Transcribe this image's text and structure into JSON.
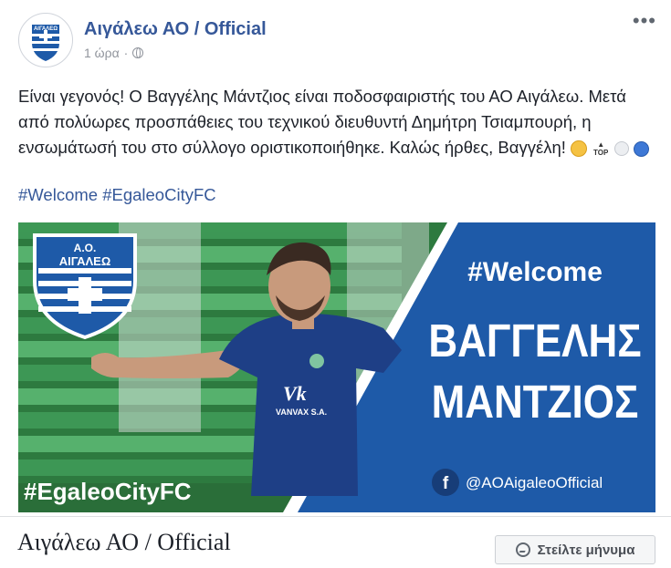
{
  "header": {
    "page_name": "Αιγάλεω ΑΟ / Official",
    "time": "1 ώρα",
    "separator": "·",
    "more_icon": "more-dots-icon",
    "privacy_icon": "globe-icon"
  },
  "post": {
    "text": "Είναι γεγονός! Ο Βαγγέλης Μάντζιος είναι ποδοσφαιριστής του ΑΟ Αιγάλεω. Μετά από πολύωρες προσπάθειες του τεχνικού διευθυντή Δημήτρη Τσιαμπουρή, η ενσωμάτωσή του στο σύλλογο οριστικοποιήθηκε. Καλώς ήρθες, Βαγγέλη!",
    "emoji": {
      "top_label": "TOP",
      "names": [
        "clapping-hands",
        "top-arrow",
        "white-circle",
        "blue-circle"
      ]
    },
    "hashtags": [
      "#Welcome",
      "#EgaleoCityFC"
    ]
  },
  "image": {
    "logo_text": "ΑΙΓΑΛΕΩ",
    "logo_abbr": "Α.Ο.",
    "welcome": "#Welcome",
    "first_name": "ΒΑΓΓΕΛΗΣ",
    "last_name": "ΜΑΝΤΖΙΟΣ",
    "social": "@AOAigaleoOfficial",
    "hashtag": "#EgaleoCityFC",
    "sponsor": "VANVAX S.A.",
    "colors": {
      "blue": "#1e5aa8",
      "dark_blue": "#173d78",
      "pitch": "#2d7a3f",
      "stands": "#3f9b58"
    }
  },
  "footer": {
    "page_name": "Αιγάλεω ΑΟ / Official",
    "message_button": "Στείλτε μήνυμα",
    "message_icon": "messenger-icon"
  }
}
